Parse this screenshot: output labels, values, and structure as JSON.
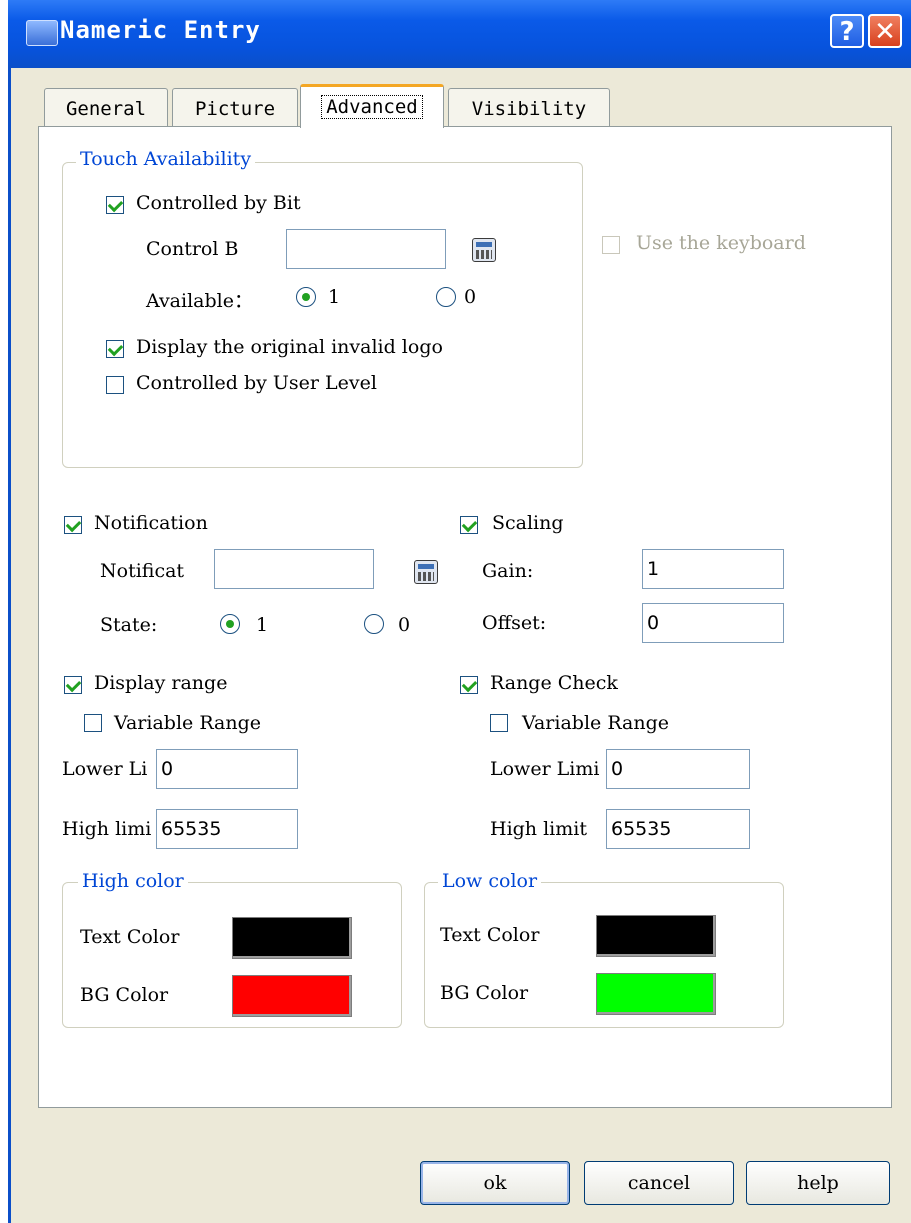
{
  "window": {
    "title": "Nameric Entry",
    "help_glyph": "?",
    "close_glyph": "✕"
  },
  "tabs": [
    {
      "label": "General",
      "active": false
    },
    {
      "label": "Picture",
      "active": false
    },
    {
      "label": "Advanced",
      "active": true
    },
    {
      "label": "Visibility",
      "active": false
    }
  ],
  "touch": {
    "legend": "Touch Availability",
    "controlled_by_bit": {
      "label": "Controlled by Bit",
      "checked": true
    },
    "control_bit_label": "Control B",
    "control_bit_value": "",
    "available_label": "Available：",
    "radio_1": {
      "label": "1",
      "checked": true
    },
    "radio_0": {
      "label": "0",
      "checked": false
    },
    "display_invalid_logo": {
      "label": "Display the original invalid logo",
      "checked": true
    },
    "controlled_by_user_level": {
      "label": "Controlled by User Level",
      "checked": false
    }
  },
  "use_keyboard": {
    "label": "Use the keyboard",
    "checked": false,
    "enabled": false
  },
  "notification": {
    "label": "Notification",
    "checked": true,
    "address_label": "Notificat",
    "address_value": "",
    "state_label": "State:",
    "radio_1": {
      "label": "1",
      "checked": true
    },
    "radio_0": {
      "label": "0",
      "checked": false
    }
  },
  "scaling": {
    "label": "Scaling",
    "checked": true,
    "gain_label": "Gain:",
    "gain_value": "1",
    "offset_label": "Offset:",
    "offset_value": "0"
  },
  "display_range": {
    "label": "Display range",
    "checked": true,
    "variable_range": {
      "label": "Variable Range",
      "checked": false
    },
    "lower_label": "Lower Li",
    "lower_value": "0",
    "high_label": "High limi",
    "high_value": "65535"
  },
  "range_check": {
    "label": "Range Check",
    "checked": true,
    "variable_range": {
      "label": "Variable Range",
      "checked": false
    },
    "lower_label": "Lower Limi",
    "lower_value": "0",
    "high_label": "High limit",
    "high_value": "65535"
  },
  "high_color": {
    "legend": "High color",
    "text_color_label": "Text Color",
    "text_color": "#000000",
    "bg_color_label": "BG Color",
    "bg_color": "#ff0000"
  },
  "low_color": {
    "legend": "Low color",
    "text_color_label": "Text Color",
    "text_color": "#000000",
    "bg_color_label": "BG Color",
    "bg_color": "#00ff00"
  },
  "buttons": {
    "ok": "ok",
    "cancel": "cancel",
    "help": "help"
  }
}
